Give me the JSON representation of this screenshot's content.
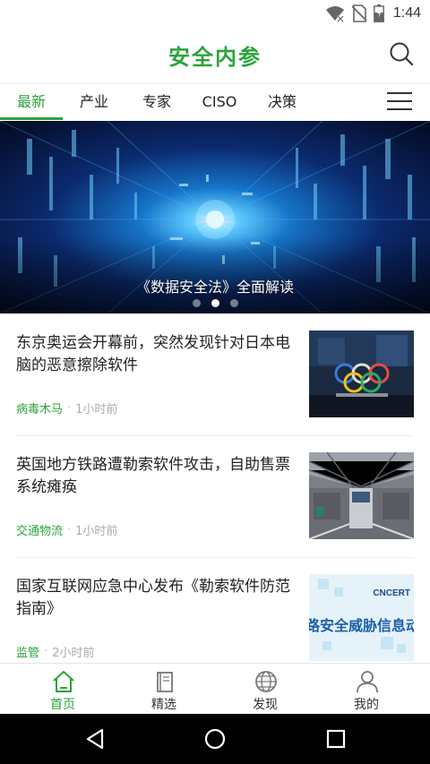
{
  "status_bar": {
    "time": "1:44"
  },
  "header": {
    "title": "安全内参"
  },
  "tabs": [
    {
      "label": "最新",
      "active": true
    },
    {
      "label": "产业",
      "active": false
    },
    {
      "label": "专家",
      "active": false
    },
    {
      "label": "CISO",
      "active": false
    },
    {
      "label": "决策",
      "active": false
    }
  ],
  "banner": {
    "caption": "《数据安全法》全面解读",
    "slide_count": 3,
    "active_slide": 2
  },
  "articles": [
    {
      "title": "东京奥运会开幕前，突然发现针对日本电脑的恶意擦除软件",
      "tag": "病毒木马",
      "time": "1小时前"
    },
    {
      "title": "英国地方铁路遭勒索软件攻击，自助售票系统瘫痪",
      "tag": "交通物流",
      "time": "1小时前"
    },
    {
      "title": "国家互联网应急中心发布《勒索软件防范指南》",
      "tag": "监管",
      "time": "2小时前",
      "thumb_text": "路安全威胁信息动",
      "thumb_logo": "CNCERT"
    }
  ],
  "bottom_nav": [
    {
      "label": "首页",
      "icon": "home-icon",
      "active": true
    },
    {
      "label": "精选",
      "icon": "book-icon",
      "active": false
    },
    {
      "label": "发现",
      "icon": "globe-icon",
      "active": false
    },
    {
      "label": "我的",
      "icon": "person-icon",
      "active": false
    }
  ],
  "colors": {
    "accent": "#2aa43a",
    "text": "#222222",
    "muted": "#aaaaaa"
  }
}
